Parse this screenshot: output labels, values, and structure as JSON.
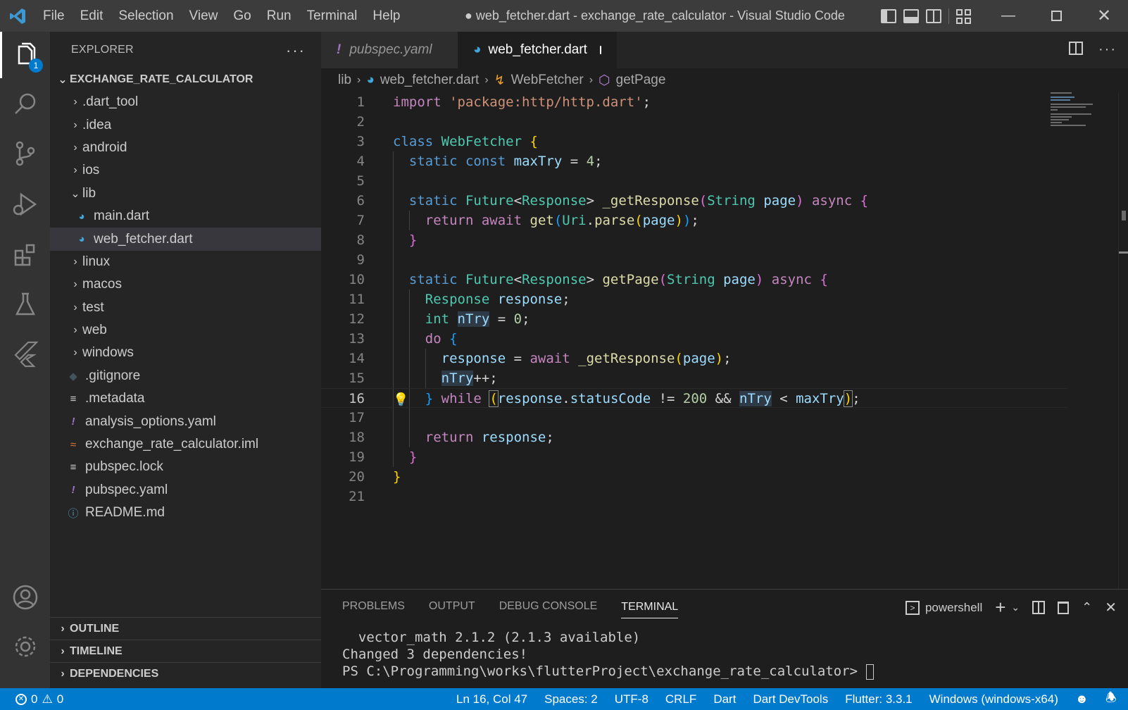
{
  "titlebar": {
    "menu": [
      "File",
      "Edit",
      "Selection",
      "View",
      "Go",
      "Run",
      "Terminal",
      "Help"
    ],
    "window_title": "● web_fetcher.dart - exchange_rate_calculator - Visual Studio Code"
  },
  "activitybar": {
    "explorer_badge": "1",
    "items": [
      "explorer-icon",
      "search-icon",
      "source-control-icon",
      "run-debug-icon",
      "extensions-icon",
      "testing-icon",
      "flutter-icon",
      "account-icon",
      "settings-gear-icon"
    ]
  },
  "sidebar": {
    "title": "EXPLORER",
    "root": "EXCHANGE_RATE_CALCULATOR",
    "tree": [
      {
        "label": ".dart_tool",
        "type": "folder"
      },
      {
        "label": ".idea",
        "type": "folder"
      },
      {
        "label": "android",
        "type": "folder"
      },
      {
        "label": "ios",
        "type": "folder"
      },
      {
        "label": "lib",
        "type": "folder-open"
      },
      {
        "label": "main.dart",
        "type": "dart"
      },
      {
        "label": "web_fetcher.dart",
        "type": "dart"
      },
      {
        "label": "linux",
        "type": "folder"
      },
      {
        "label": "macos",
        "type": "folder"
      },
      {
        "label": "test",
        "type": "folder"
      },
      {
        "label": "web",
        "type": "folder"
      },
      {
        "label": "windows",
        "type": "folder"
      },
      {
        "label": ".gitignore",
        "type": "git"
      },
      {
        "label": ".metadata",
        "type": "text"
      },
      {
        "label": "analysis_options.yaml",
        "type": "yaml"
      },
      {
        "label": "exchange_rate_calculator.iml",
        "type": "rss"
      },
      {
        "label": "pubspec.lock",
        "type": "text"
      },
      {
        "label": "pubspec.yaml",
        "type": "yaml"
      },
      {
        "label": "README.md",
        "type": "info"
      }
    ],
    "sections": [
      "OUTLINE",
      "TIMELINE",
      "DEPENDENCIES"
    ]
  },
  "tabs": [
    {
      "label": "pubspec.yaml",
      "icon": "!"
    },
    {
      "label": "web_fetcher.dart"
    }
  ],
  "breadcrumb": [
    "lib",
    "web_fetcher.dart",
    "WebFetcher",
    "getPage"
  ],
  "editor": {
    "line_numbers": [
      "1",
      "2",
      "3",
      "4",
      "5",
      "6",
      "7",
      "8",
      "9",
      "10",
      "11",
      "12",
      "13",
      "14",
      "15",
      "16",
      "17",
      "18",
      "19",
      "20",
      "21"
    ],
    "current_line": 16
  },
  "panel": {
    "tabs": [
      "PROBLEMS",
      "OUTPUT",
      "DEBUG CONSOLE",
      "TERMINAL"
    ],
    "shell": "powershell",
    "terminal_lines": [
      "  vector_math 2.1.2 (2.1.3 available)",
      "Changed 3 dependencies!",
      "PS C:\\Programming\\works\\flutterProject\\exchange_rate_calculator> "
    ]
  },
  "statusbar": {
    "errors": "0",
    "warnings": "0",
    "position": "Ln 16, Col 47",
    "spaces": "Spaces: 2",
    "encoding": "UTF-8",
    "eol": "CRLF",
    "language": "Dart",
    "devtools": "Dart DevTools",
    "flutter": "Flutter: 3.3.1",
    "device": "Windows (windows-x64)"
  },
  "colors": {
    "accent": "#007acc",
    "keyword": "#569cd6",
    "control": "#c586c0",
    "string": "#ce9178",
    "type": "#4ec9b0",
    "function": "#dcdcaa",
    "variable": "#9cdcfe"
  }
}
